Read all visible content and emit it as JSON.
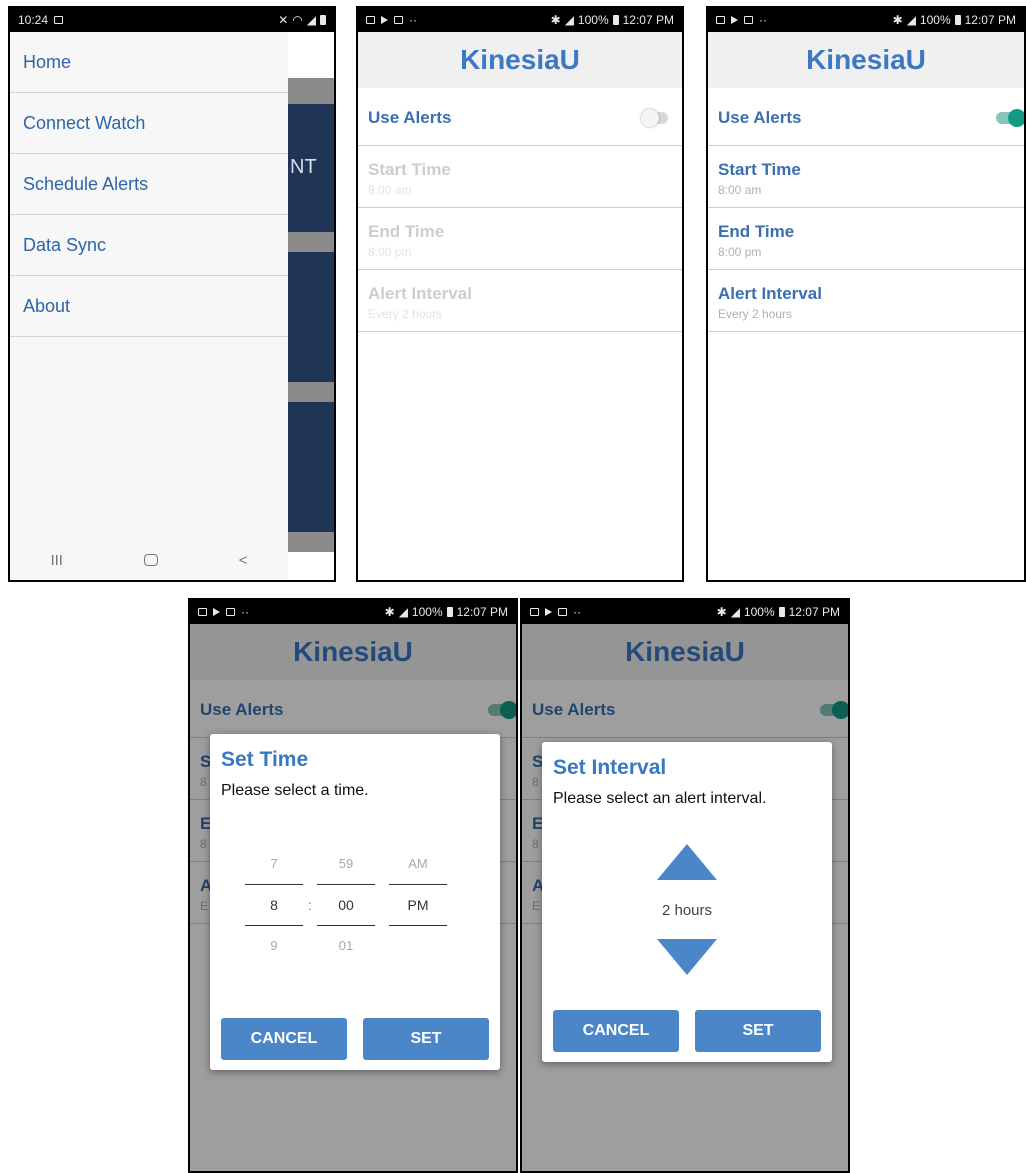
{
  "screen1": {
    "status_time": "10:24",
    "menu": [
      "Home",
      "Connect Watch",
      "Schedule Alerts",
      "Data Sync",
      "About"
    ],
    "bg_text": "NT",
    "nav": {
      "recent": "III",
      "back": "<"
    }
  },
  "status_bar": {
    "battery": "100%",
    "time": "12:07 PM"
  },
  "app": {
    "title": "KinesiaU",
    "use_alerts": "Use Alerts",
    "start_time": "Start Time",
    "start_value": "8:00 am",
    "end_time": "End Time",
    "end_value": "8:00 pm",
    "alert_interval": "Alert Interval",
    "interval_value": "Every 2 hours"
  },
  "screen2": {
    "use_alerts_on": false
  },
  "screen3": {
    "use_alerts_on": true
  },
  "time_dialog": {
    "title": "Set Time",
    "message": "Please select a time.",
    "hour": {
      "prev": "7",
      "current": "8",
      "next": "9"
    },
    "minute": {
      "prev": "59",
      "current": "00",
      "next": "01"
    },
    "ampm": {
      "prev": "AM",
      "current": "PM"
    },
    "separator": ":",
    "cancel": "CANCEL",
    "set": "SET"
  },
  "interval_dialog": {
    "title": "Set Interval",
    "message": "Please select an alert interval.",
    "value": "2 hours",
    "cancel": "CANCEL",
    "set": "SET"
  },
  "partial_labels": {
    "start": "S",
    "start_sub": "8",
    "end": "E",
    "end_sub": "8",
    "alert": "A",
    "alert_sub": "E"
  },
  "colors": {
    "accent": "#3d78c3",
    "button": "#4a86c8",
    "toggle_on": "#129a86",
    "drawer_bg": "#1f3456"
  }
}
